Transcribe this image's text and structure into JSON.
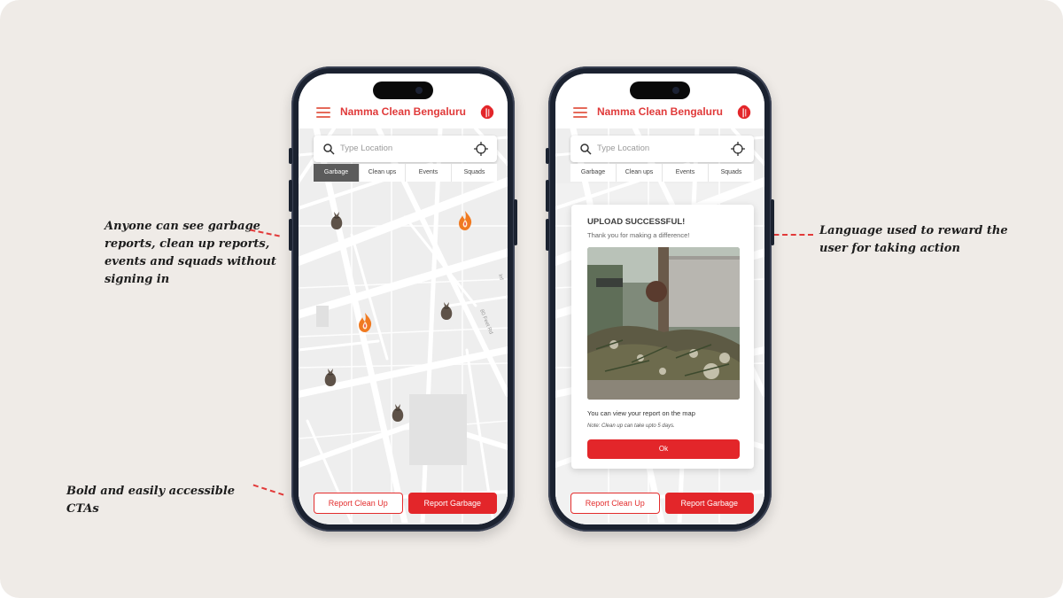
{
  "annotations": {
    "left_1": "Anyone can see garbage reports, clean up reports, events and squads without signing in",
    "left_2": "Bold and easily accessible CTAs",
    "right_1": "Language used to reward the user for taking action"
  },
  "app": {
    "title": "Namma Clean Bengaluru",
    "search_placeholder": "Type Location",
    "tabs": [
      "Garbage",
      "Clean ups",
      "Events",
      "Squads"
    ],
    "active_tab_left": "Garbage",
    "cta_cleanup": "Report Clean Up",
    "cta_garbage": "Report Garbage"
  },
  "map_labels": {
    "road_1": "80 Feet Rd",
    "road_2": "Inf"
  },
  "modal": {
    "title": "UPLOAD SUCCESSFUL!",
    "subtitle": "Thank you for making a difference!",
    "message": "You can view your report on the map",
    "note": "Note: Clean up can take upto 5 days.",
    "ok_label": "Ok"
  },
  "colors": {
    "accent": "#e3262a",
    "background": "#efebe7",
    "phone_frame": "#1b2230"
  },
  "icons": {
    "menu": "hamburger-icon",
    "profile": "tomato-logo-icon",
    "search": "search-icon",
    "locate": "crosshair-icon",
    "garbage": "garbage-bag-icon",
    "cleanup": "flame-icon"
  }
}
